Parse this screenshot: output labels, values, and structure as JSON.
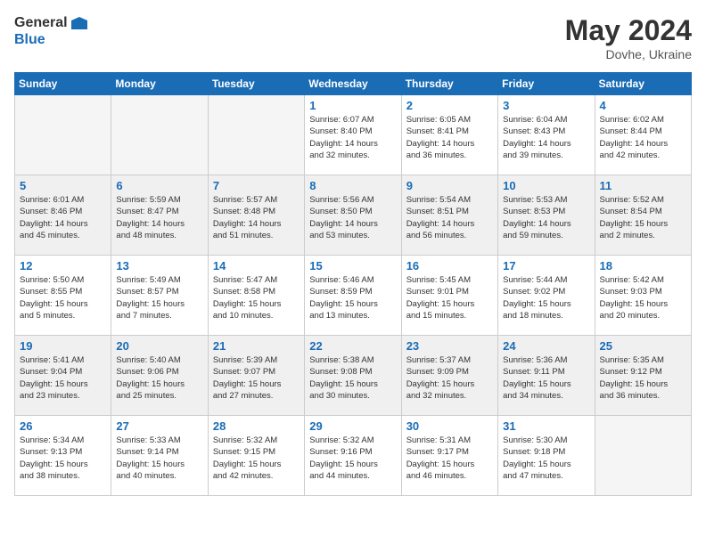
{
  "header": {
    "logo_text_general": "General",
    "logo_text_blue": "Blue",
    "month": "May 2024",
    "location": "Dovhe, Ukraine"
  },
  "weekdays": [
    "Sunday",
    "Monday",
    "Tuesday",
    "Wednesday",
    "Thursday",
    "Friday",
    "Saturday"
  ],
  "weeks": [
    [
      {
        "day": "",
        "info": ""
      },
      {
        "day": "",
        "info": ""
      },
      {
        "day": "",
        "info": ""
      },
      {
        "day": "1",
        "info": "Sunrise: 6:07 AM\nSunset: 8:40 PM\nDaylight: 14 hours\nand 32 minutes."
      },
      {
        "day": "2",
        "info": "Sunrise: 6:05 AM\nSunset: 8:41 PM\nDaylight: 14 hours\nand 36 minutes."
      },
      {
        "day": "3",
        "info": "Sunrise: 6:04 AM\nSunset: 8:43 PM\nDaylight: 14 hours\nand 39 minutes."
      },
      {
        "day": "4",
        "info": "Sunrise: 6:02 AM\nSunset: 8:44 PM\nDaylight: 14 hours\nand 42 minutes."
      }
    ],
    [
      {
        "day": "5",
        "info": "Sunrise: 6:01 AM\nSunset: 8:46 PM\nDaylight: 14 hours\nand 45 minutes."
      },
      {
        "day": "6",
        "info": "Sunrise: 5:59 AM\nSunset: 8:47 PM\nDaylight: 14 hours\nand 48 minutes."
      },
      {
        "day": "7",
        "info": "Sunrise: 5:57 AM\nSunset: 8:48 PM\nDaylight: 14 hours\nand 51 minutes."
      },
      {
        "day": "8",
        "info": "Sunrise: 5:56 AM\nSunset: 8:50 PM\nDaylight: 14 hours\nand 53 minutes."
      },
      {
        "day": "9",
        "info": "Sunrise: 5:54 AM\nSunset: 8:51 PM\nDaylight: 14 hours\nand 56 minutes."
      },
      {
        "day": "10",
        "info": "Sunrise: 5:53 AM\nSunset: 8:53 PM\nDaylight: 14 hours\nand 59 minutes."
      },
      {
        "day": "11",
        "info": "Sunrise: 5:52 AM\nSunset: 8:54 PM\nDaylight: 15 hours\nand 2 minutes."
      }
    ],
    [
      {
        "day": "12",
        "info": "Sunrise: 5:50 AM\nSunset: 8:55 PM\nDaylight: 15 hours\nand 5 minutes."
      },
      {
        "day": "13",
        "info": "Sunrise: 5:49 AM\nSunset: 8:57 PM\nDaylight: 15 hours\nand 7 minutes."
      },
      {
        "day": "14",
        "info": "Sunrise: 5:47 AM\nSunset: 8:58 PM\nDaylight: 15 hours\nand 10 minutes."
      },
      {
        "day": "15",
        "info": "Sunrise: 5:46 AM\nSunset: 8:59 PM\nDaylight: 15 hours\nand 13 minutes."
      },
      {
        "day": "16",
        "info": "Sunrise: 5:45 AM\nSunset: 9:01 PM\nDaylight: 15 hours\nand 15 minutes."
      },
      {
        "day": "17",
        "info": "Sunrise: 5:44 AM\nSunset: 9:02 PM\nDaylight: 15 hours\nand 18 minutes."
      },
      {
        "day": "18",
        "info": "Sunrise: 5:42 AM\nSunset: 9:03 PM\nDaylight: 15 hours\nand 20 minutes."
      }
    ],
    [
      {
        "day": "19",
        "info": "Sunrise: 5:41 AM\nSunset: 9:04 PM\nDaylight: 15 hours\nand 23 minutes."
      },
      {
        "day": "20",
        "info": "Sunrise: 5:40 AM\nSunset: 9:06 PM\nDaylight: 15 hours\nand 25 minutes."
      },
      {
        "day": "21",
        "info": "Sunrise: 5:39 AM\nSunset: 9:07 PM\nDaylight: 15 hours\nand 27 minutes."
      },
      {
        "day": "22",
        "info": "Sunrise: 5:38 AM\nSunset: 9:08 PM\nDaylight: 15 hours\nand 30 minutes."
      },
      {
        "day": "23",
        "info": "Sunrise: 5:37 AM\nSunset: 9:09 PM\nDaylight: 15 hours\nand 32 minutes."
      },
      {
        "day": "24",
        "info": "Sunrise: 5:36 AM\nSunset: 9:11 PM\nDaylight: 15 hours\nand 34 minutes."
      },
      {
        "day": "25",
        "info": "Sunrise: 5:35 AM\nSunset: 9:12 PM\nDaylight: 15 hours\nand 36 minutes."
      }
    ],
    [
      {
        "day": "26",
        "info": "Sunrise: 5:34 AM\nSunset: 9:13 PM\nDaylight: 15 hours\nand 38 minutes."
      },
      {
        "day": "27",
        "info": "Sunrise: 5:33 AM\nSunset: 9:14 PM\nDaylight: 15 hours\nand 40 minutes."
      },
      {
        "day": "28",
        "info": "Sunrise: 5:32 AM\nSunset: 9:15 PM\nDaylight: 15 hours\nand 42 minutes."
      },
      {
        "day": "29",
        "info": "Sunrise: 5:32 AM\nSunset: 9:16 PM\nDaylight: 15 hours\nand 44 minutes."
      },
      {
        "day": "30",
        "info": "Sunrise: 5:31 AM\nSunset: 9:17 PM\nDaylight: 15 hours\nand 46 minutes."
      },
      {
        "day": "31",
        "info": "Sunrise: 5:30 AM\nSunset: 9:18 PM\nDaylight: 15 hours\nand 47 minutes."
      },
      {
        "day": "",
        "info": ""
      }
    ]
  ]
}
